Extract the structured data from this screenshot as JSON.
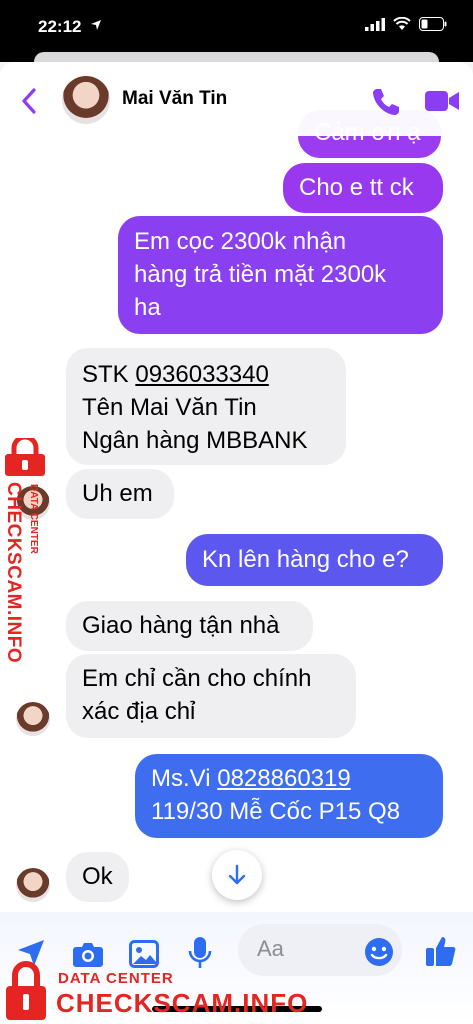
{
  "status": {
    "time": "22:12"
  },
  "header": {
    "name": "Mai Văn Tin"
  },
  "messages": [
    {
      "dir": "out",
      "text": "Cảm ơn ạ"
    },
    {
      "dir": "out",
      "text": "Cho e tt ck"
    },
    {
      "dir": "out",
      "lines": [
        "Em cọc 2300k nhận",
        "hàng trả tiền mặt 2300k",
        "ha"
      ]
    },
    {
      "dir": "in",
      "stk_label": "STK ",
      "stk_number": "0936033340",
      "lines": [
        "Tên Mai Văn Tin",
        "Ngân hàng MBBANK"
      ]
    },
    {
      "dir": "in",
      "text": "Uh em"
    },
    {
      "dir": "out",
      "text": "Kn lên hàng cho e?"
    },
    {
      "dir": "in",
      "text": "Giao hàng tận nhà"
    },
    {
      "dir": "in",
      "lines": [
        "Em chỉ cần cho chính",
        "xác địa chỉ"
      ]
    },
    {
      "dir": "out",
      "ms_label": "Ms.Vi ",
      "phone": "0828860319",
      "lines": [
        "119/30 Mễ Cốc P15 Q8"
      ]
    },
    {
      "dir": "in",
      "text": "Ok"
    }
  ],
  "composer": {
    "placeholder": "Aa"
  },
  "watermark": {
    "side_label": "DATA CENTER",
    "side_brand": "CHECKSCAM.INFO",
    "bottom_label": "DATA CENTER",
    "bottom_brand": "CHECKSCAM.INFO"
  },
  "colors": {
    "accent": "#8b3cf5",
    "bubble_top": "#9b3cf0",
    "bubble_bottom": "#3f6df0",
    "incoming": "#efeff1",
    "watermark": "#e52521"
  },
  "icons": [
    "location-arrow-icon",
    "wifi-icon",
    "signal-icon",
    "battery-icon",
    "back-chevron-icon",
    "phone-icon",
    "video-icon",
    "arrow-down-icon",
    "send-arrow-icon",
    "camera-icon",
    "image-icon",
    "microphone-icon",
    "emoji-icon",
    "like-icon",
    "lock-icon"
  ]
}
